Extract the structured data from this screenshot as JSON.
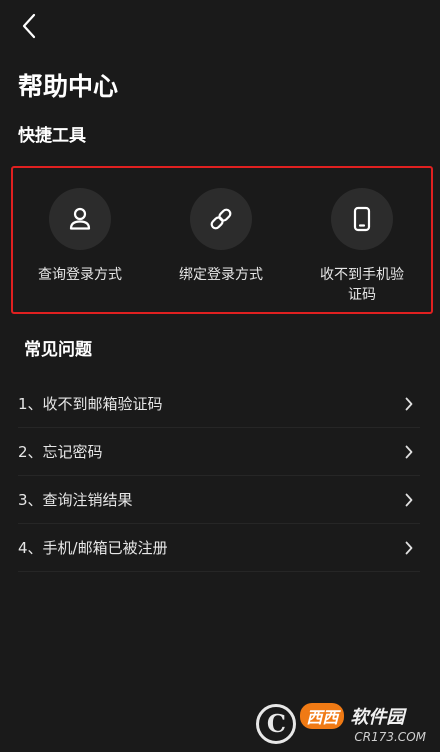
{
  "header": {
    "back_icon": "chevron-left-icon",
    "title": "帮助中心"
  },
  "tools": {
    "section_title": "快捷工具",
    "highlight_color": "#e02020",
    "items": [
      {
        "label": "查询登录方式",
        "icon": "user-icon"
      },
      {
        "label": "绑定登录方式",
        "icon": "link-icon"
      },
      {
        "label": "收不到手机验证码",
        "icon": "phone-icon"
      }
    ]
  },
  "faq": {
    "section_title": "常见问题",
    "items": [
      {
        "text": "1、收不到邮箱验证码"
      },
      {
        "text": "2、忘记密码"
      },
      {
        "text": "3、查询注销结果"
      },
      {
        "text": "4、手机/邮箱已被注册"
      }
    ]
  },
  "watermark": {
    "logo": "C",
    "badge": "西西",
    "name": "软件园",
    "url": "CR173.COM"
  }
}
